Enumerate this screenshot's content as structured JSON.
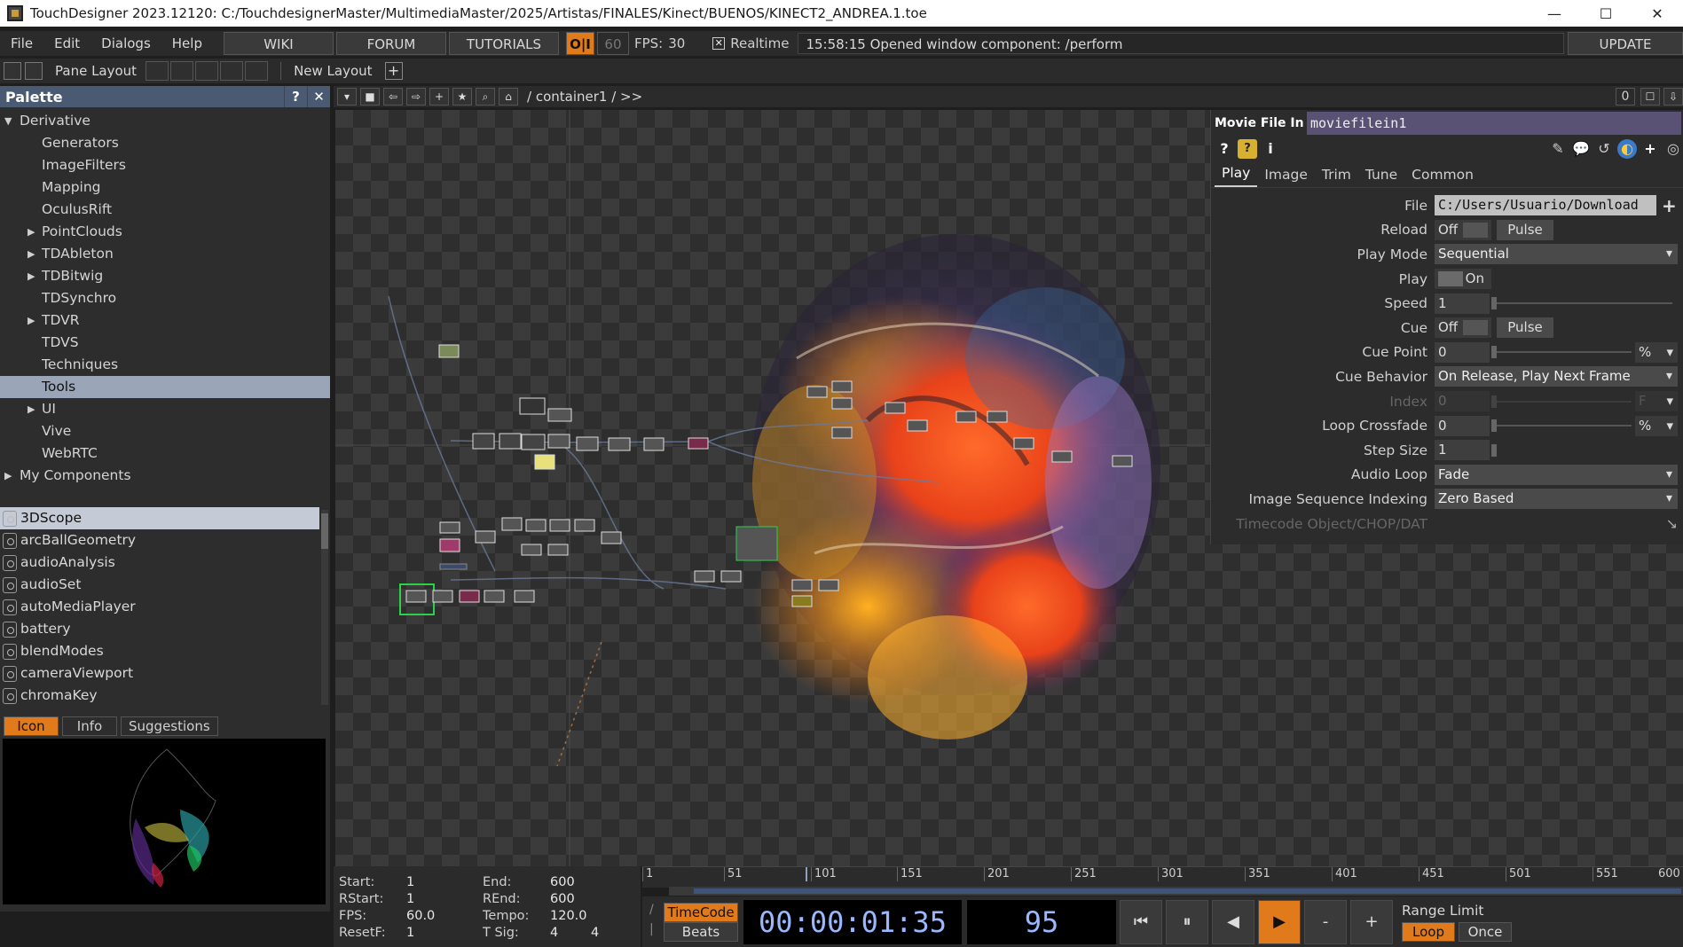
{
  "window": {
    "title": "TouchDesigner 2023.12120: C:/TouchdesignerMaster/MultimediaMaster/2025/Artistas/FINALES/Kinect/BUENOS/KINECT2_ANDREA.1.toe",
    "minimize": "—",
    "maximize": "☐",
    "close": "✕"
  },
  "menubar": {
    "file": "File",
    "edit": "Edit",
    "dialogs": "Dialogs",
    "help": "Help",
    "wiki": "WIKI",
    "forum": "FORUM",
    "tutorials": "TUTORIALS",
    "oi": "O|I",
    "sixty": "60",
    "fps_label": "FPS:",
    "fps_value": "30",
    "realtime_check": "✕",
    "realtime": "Realtime",
    "status": "15:58:15 Opened window component: /perform",
    "update": "UPDATE"
  },
  "toolbar2": {
    "pane_layout": "Pane Layout",
    "new_layout": "New Layout",
    "plus": "+"
  },
  "palette": {
    "title": "Palette",
    "help": "?",
    "close": "✕",
    "tree": [
      {
        "label": "Derivative",
        "level": 0,
        "arrow": "▼"
      },
      {
        "label": "Generators",
        "level": 1,
        "arrow": ""
      },
      {
        "label": "ImageFilters",
        "level": 1,
        "arrow": ""
      },
      {
        "label": "Mapping",
        "level": 1,
        "arrow": ""
      },
      {
        "label": "OculusRift",
        "level": 1,
        "arrow": ""
      },
      {
        "label": "PointClouds",
        "level": 1,
        "arrow": "▶"
      },
      {
        "label": "TDAbleton",
        "level": 1,
        "arrow": "▶"
      },
      {
        "label": "TDBitwig",
        "level": 1,
        "arrow": "▶"
      },
      {
        "label": "TDSynchro",
        "level": 1,
        "arrow": ""
      },
      {
        "label": "TDVR",
        "level": 1,
        "arrow": "▶"
      },
      {
        "label": "TDVS",
        "level": 1,
        "arrow": ""
      },
      {
        "label": "Techniques",
        "level": 1,
        "arrow": ""
      },
      {
        "label": "Tools",
        "level": 1,
        "arrow": "",
        "selected": true
      },
      {
        "label": "UI",
        "level": 1,
        "arrow": "▶"
      },
      {
        "label": "Vive",
        "level": 1,
        "arrow": ""
      },
      {
        "label": "WebRTC",
        "level": 1,
        "arrow": ""
      },
      {
        "label": "My Components",
        "level": 0,
        "arrow": "▶"
      }
    ],
    "components": [
      "3DScope",
      "arcBallGeometry",
      "audioAnalysis",
      "audioSet",
      "autoMediaPlayer",
      "battery",
      "blendModes",
      "cameraViewport",
      "chromaKey"
    ],
    "tabs": {
      "icon": "Icon",
      "info": "Info",
      "suggestions": "Suggestions"
    }
  },
  "netbar": {
    "path": "/ container1 / >>",
    "zero": "0"
  },
  "params": {
    "op_type": "Movie File In",
    "op_name": "moviefilein1",
    "tabs": [
      "Play",
      "Image",
      "Trim",
      "Tune",
      "Common"
    ],
    "file_label": "File",
    "file_value": "C:/Users/Usuario/Download",
    "reload_label": "Reload",
    "reload_value": "Off",
    "pulse": "Pulse",
    "playmode_label": "Play Mode",
    "playmode_value": "Sequential",
    "play_label": "Play",
    "play_value": "On",
    "speed_label": "Speed",
    "speed_value": "1",
    "cue_label": "Cue",
    "cue_value": "Off",
    "cuepoint_label": "Cue Point",
    "cuepoint_value": "0",
    "cuepoint_unit": "%",
    "cuebehavior_label": "Cue Behavior",
    "cuebehavior_value": "On Release, Play Next Frame",
    "index_label": "Index",
    "index_value": "0",
    "index_unit": "F",
    "loopcrossfade_label": "Loop Crossfade",
    "loopcrossfade_value": "0",
    "loopcrossfade_unit": "%",
    "stepsize_label": "Step Size",
    "stepsize_value": "1",
    "audioloop_label": "Audio Loop",
    "audioloop_value": "Fade",
    "imgseq_label": "Image Sequence Indexing",
    "imgseq_value": "Zero Based",
    "timecode_label": "Timecode Object/CHOP/DAT"
  },
  "timeinfo": {
    "start_label": "Start:",
    "start": "1",
    "end_label": "End:",
    "end": "600",
    "rstart_label": "RStart:",
    "rstart": "1",
    "rend_label": "REnd:",
    "rend": "600",
    "fps_label": "FPS:",
    "fps": "60.0",
    "tempo_label": "Tempo:",
    "tempo": "120.0",
    "resetf_label": "ResetF:",
    "resetf": "1",
    "tsig_label": "T Sig:",
    "tsig_a": "4",
    "tsig_b": "4"
  },
  "timeline": {
    "ticks": [
      "1",
      "51",
      "101",
      "151",
      "201",
      "251",
      "301",
      "351",
      "401",
      "451",
      "501",
      "551",
      "600"
    ]
  },
  "transport": {
    "timecode": "TimeCode",
    "beats": "Beats",
    "tc_display": "00:00:01:35",
    "frame": "95",
    "to_start": "⏮",
    "pause": "⏸",
    "step_back": "◀",
    "play": "▶",
    "minus": "-",
    "plus": "+",
    "range_limit": "Range Limit",
    "loop": "Loop",
    "once": "Once"
  },
  "colors": {
    "accent": "#e07a1a",
    "palette_header": "#4a5a72",
    "op_name_bg": "#5a5275"
  }
}
